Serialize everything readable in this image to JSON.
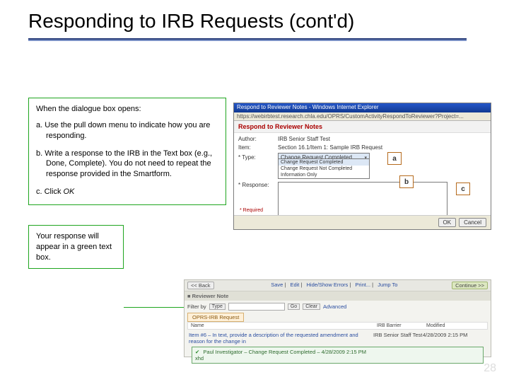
{
  "title": "Responding to IRB Requests (cont'd)",
  "box1": {
    "lead": "When the dialogue box opens:",
    "a": "a. Use the pull down menu to indicate how you are responding.",
    "b": "b. Write a response to the IRB in the Text box (e.g., Done, Complete). You do not need to repeat the response provided in the Smartform.",
    "c_prefix": "c. Click ",
    "c_action": "OK"
  },
  "box2": "Your response will appear in a green text box.",
  "callouts": {
    "a": "a",
    "b": "b",
    "c": "c"
  },
  "dialog": {
    "window_title": "Respond to Reviewer Notes - Windows Internet Explorer",
    "url": "https://webirbtest.research.chla.edu/OPRS/CustomActivityRespondToReviewer?Project=...",
    "heading": "Respond to Reviewer Notes",
    "author_label": "Author:",
    "author_value": "IRB Senior Staff Test",
    "item_label": "Item:",
    "item_value": "Section 16.1/Item 1: Sample IRB Request",
    "type_label": "* Type:",
    "type_selected": "Change Request Completed",
    "type_options": [
      "Change Request Completed",
      "Change Request Not Completed",
      "Information Only"
    ],
    "response_label": "* Response:",
    "required": "* Required",
    "ok": "OK",
    "cancel": "Cancel"
  },
  "panel": {
    "back": "<< Back",
    "toolbar_links": [
      "Save",
      "Edit",
      "Hide/Show Errors",
      "Print...",
      "Jump To"
    ],
    "continue": "Continue >>",
    "section": "Reviewer Note",
    "filter_label": "Filter by",
    "filter_field": "Type",
    "go": "Go",
    "clear": "Clear",
    "adv": "Advanced",
    "tab": "OPRS-IRB Request",
    "col_name": "Name",
    "col_barrier": "IRB Barrier",
    "col_modified": "Modified",
    "row_name": "Item #6 – In text, provide a description of the requested amendment and reason for the change in",
    "row_barrier": "IRB Senior Staff Test",
    "row_modified": "4/28/2009 2:15 PM",
    "resp_line": "Paul Investigator – Change Request Completed – 4/28/2009 2:15 PM",
    "resp_text": "xhd"
  },
  "pagenum": "28"
}
